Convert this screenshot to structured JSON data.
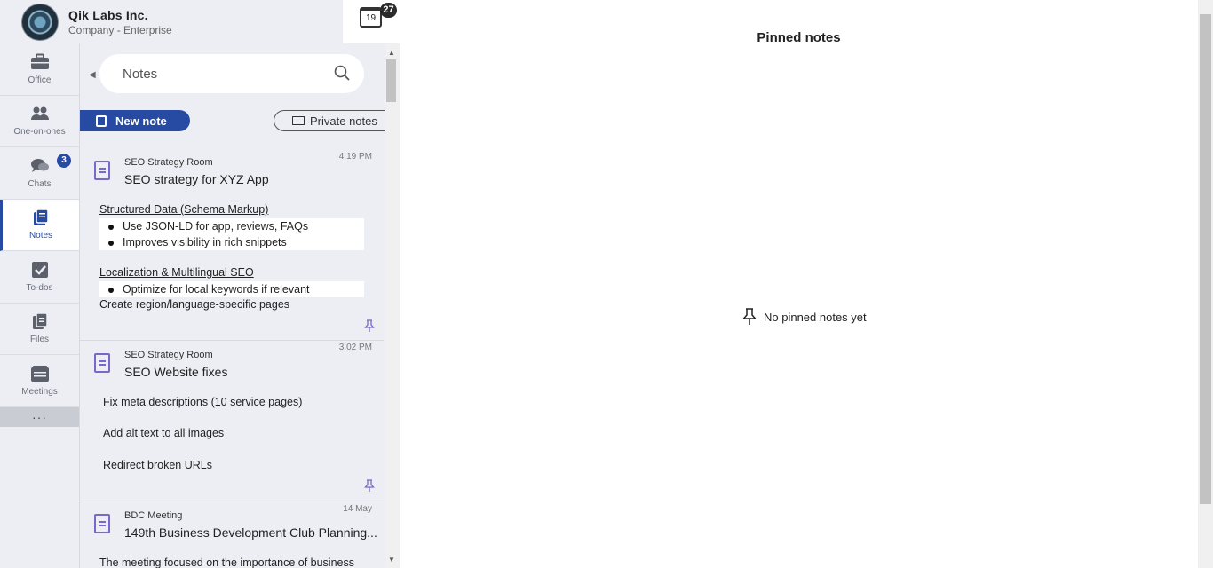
{
  "header": {
    "company_name": "Qik Labs Inc.",
    "company_sub": "Company - Enterprise",
    "calendar_day": "19",
    "calendar_badge": "27"
  },
  "nav": {
    "items": [
      {
        "label": "Office",
        "icon": "briefcase-icon"
      },
      {
        "label": "One-on-ones",
        "icon": "people-icon"
      },
      {
        "label": "Chats",
        "icon": "chat-bubbles-icon",
        "badge": "3"
      },
      {
        "label": "Notes",
        "icon": "notes-icon",
        "active": true
      },
      {
        "label": "To-dos",
        "icon": "checkbox-icon"
      },
      {
        "label": "Files",
        "icon": "files-icon"
      },
      {
        "label": "Meetings",
        "icon": "meetings-icon"
      }
    ],
    "more": "···"
  },
  "panel": {
    "search_placeholder": "Notes",
    "new_note_label": "New note",
    "private_notes_label": "Private notes"
  },
  "notes": [
    {
      "room": "SEO Strategy Room",
      "time": "4:19 PM",
      "title": "SEO strategy for XYZ App",
      "section1": "Structured Data (Schema Markup)",
      "bullets1": [
        "Use JSON-LD for app, reviews, FAQs",
        "Improves visibility in rich snippets"
      ],
      "section2": "Localization & Multilingual SEO",
      "bullets2": [
        "Optimize for local keywords if relevant"
      ],
      "line": "Create region/language-specific pages"
    },
    {
      "room": "SEO Strategy Room",
      "time": "3:02 PM",
      "title": "SEO Website fixes",
      "lines": [
        "Fix meta descriptions (10 service pages)",
        "Add alt text to all images",
        "Redirect broken URLs"
      ]
    },
    {
      "room": "BDC Meeting",
      "time": "14 May",
      "title": "149th Business Development Club Planning...",
      "preview": "The meeting focused on the importance of business"
    }
  ],
  "content": {
    "title": "Pinned notes",
    "empty_text": "No pinned notes yet"
  },
  "colors": {
    "accent": "#274ba2",
    "note_icon": "#7a67c7",
    "sidebar_bg": "#eceef4"
  }
}
